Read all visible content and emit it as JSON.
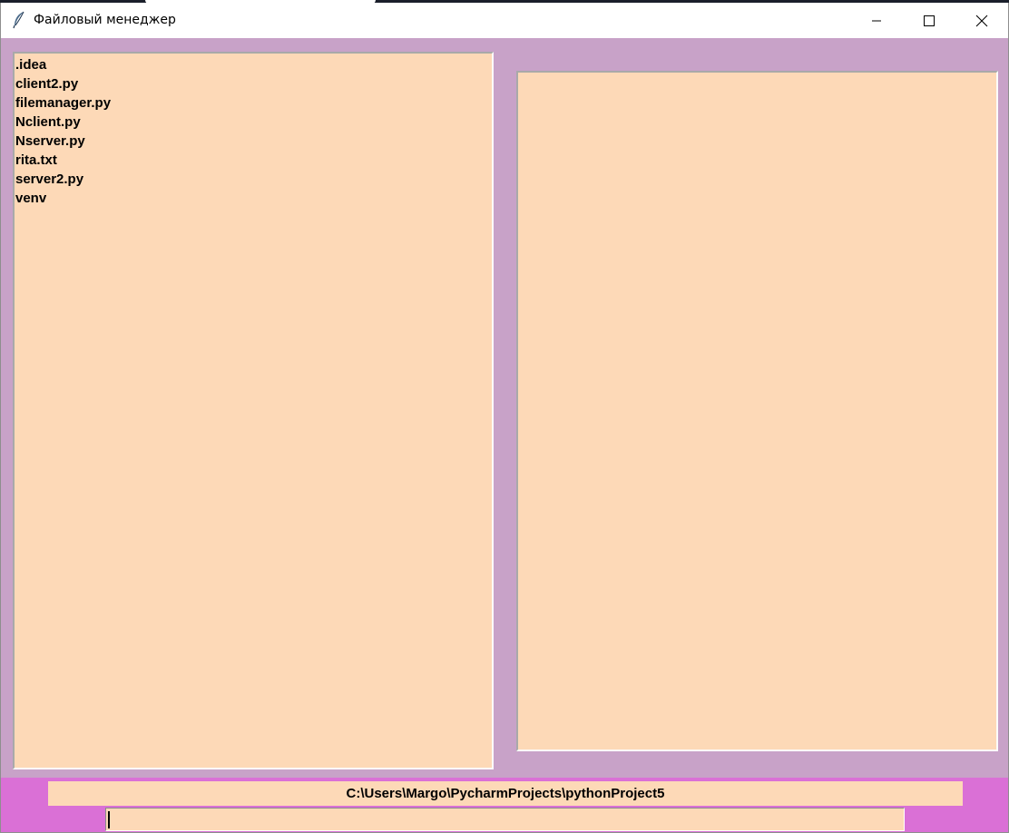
{
  "window": {
    "title": "Файловый менеджер",
    "icon": "feather-icon",
    "controls": [
      "minimize-icon",
      "maximize-icon",
      "close-icon"
    ]
  },
  "file_list": {
    "items": [
      ".idea",
      "client2.py",
      "filemanager.py",
      "Nclient.py",
      "Nserver.py",
      "rita.txt",
      "server2.py",
      "venv"
    ]
  },
  "preview": {
    "content": ""
  },
  "status": {
    "path": "C:\\Users\\Margo\\PycharmProjects\\pythonProject5"
  },
  "command_entry": {
    "value": ""
  },
  "colors": {
    "window_bg": "#c8a2c8",
    "panel_bg": "#fdd9b7",
    "bottom_bg": "#da70d6"
  }
}
